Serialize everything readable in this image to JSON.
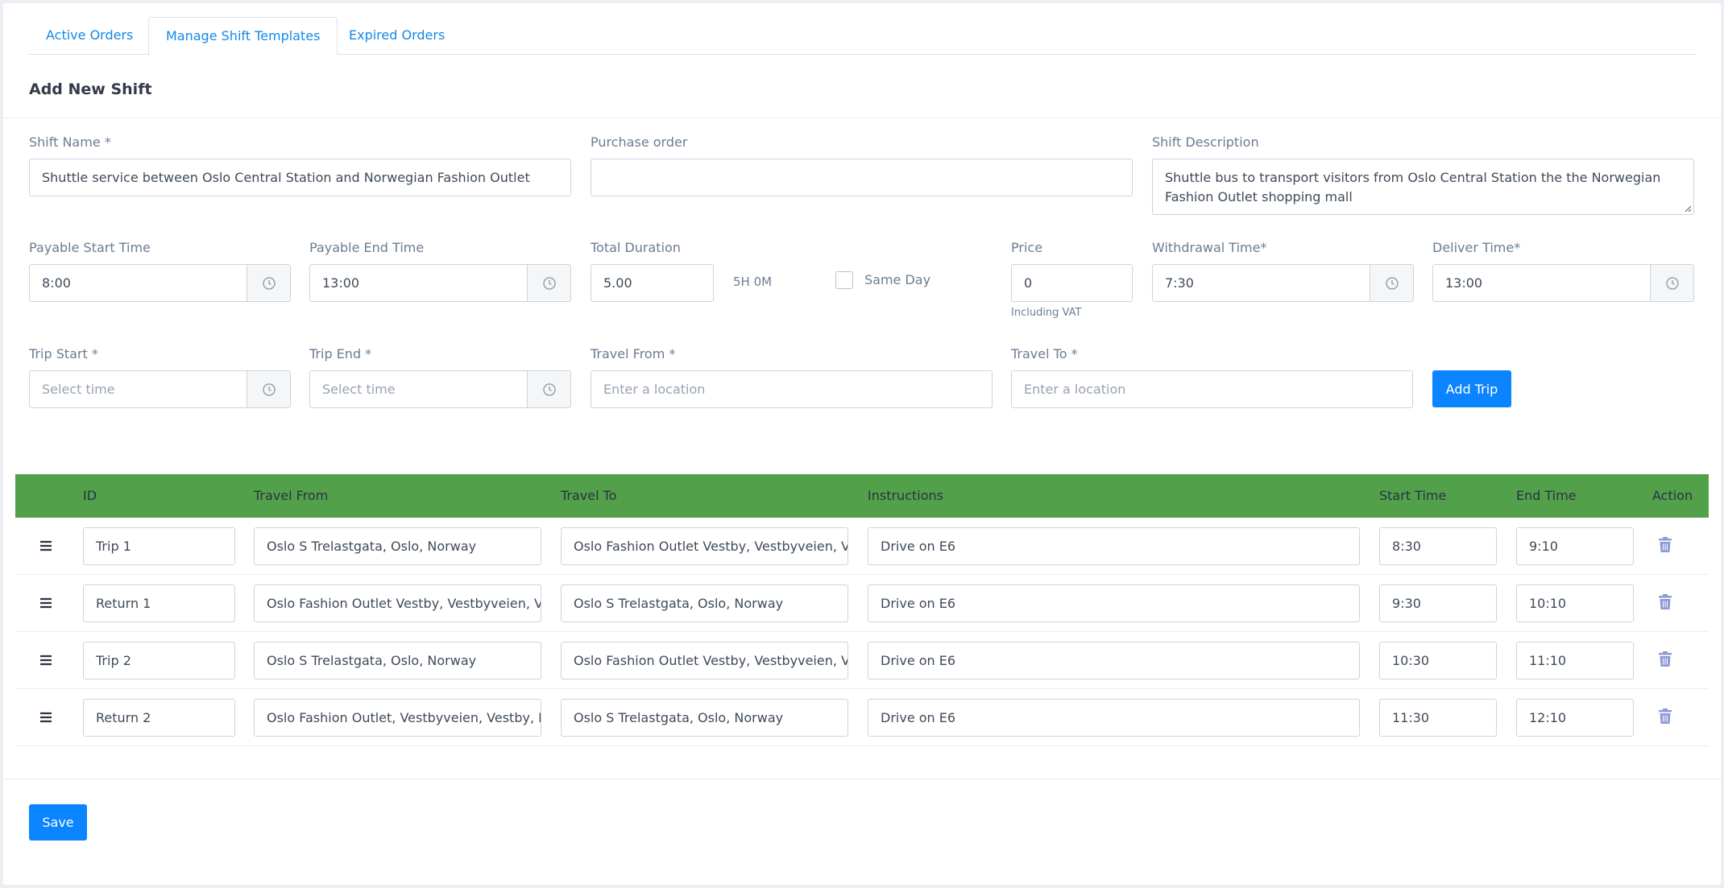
{
  "tabs": [
    {
      "label": "Active Orders",
      "active": false
    },
    {
      "label": "Manage Shift Templates",
      "active": true
    },
    {
      "label": "Expired Orders",
      "active": false
    }
  ],
  "section_title": "Add New Shift",
  "form": {
    "shift_name": {
      "label": "Shift Name *",
      "value": "Shuttle service between Oslo Central Station and Norwegian Fashion Outlet"
    },
    "purchase_order": {
      "label": "Purchase order",
      "value": ""
    },
    "shift_description": {
      "label": "Shift Description",
      "value": "Shuttle bus to transport visitors from Oslo Central Station the the Norwegian Fashion Outlet shopping mall"
    },
    "payable_start": {
      "label": "Payable Start Time",
      "value": "8:00"
    },
    "payable_end": {
      "label": "Payable End Time",
      "value": "13:00"
    },
    "total_duration": {
      "label": "Total Duration",
      "value": "5.00",
      "display": "5H 0M"
    },
    "same_day": {
      "label": "Same Day",
      "checked": false
    },
    "price": {
      "label": "Price",
      "value": "0",
      "hint": "Including VAT"
    },
    "withdrawal_time": {
      "label": "Withdrawal Time*",
      "value": "7:30"
    },
    "deliver_time": {
      "label": "Deliver Time*",
      "value": "13:00"
    },
    "trip_start": {
      "label": "Trip Start *",
      "placeholder": "Select time"
    },
    "trip_end": {
      "label": "Trip End *",
      "placeholder": "Select time"
    },
    "travel_from": {
      "label": "Travel From *",
      "placeholder": "Enter a location"
    },
    "travel_to": {
      "label": "Travel To *",
      "placeholder": "Enter a location"
    },
    "add_trip_label": "Add Trip"
  },
  "table": {
    "headers": [
      "ID",
      "Travel From",
      "Travel To",
      "Instructions",
      "Start Time",
      "End Time",
      "Action"
    ],
    "rows": [
      {
        "id": "Trip 1",
        "from": "Oslo S Trelastgata, Oslo, Norway",
        "to": "Oslo Fashion Outlet Vestby, Vestbyveien, Vestby, Norway",
        "instructions": "Drive on E6",
        "start": "8:30",
        "end": "9:10"
      },
      {
        "id": "Return 1",
        "from": "Oslo Fashion Outlet Vestby, Vestbyveien, Vestby, Norway",
        "to": "Oslo S Trelastgata, Oslo, Norway",
        "instructions": "Drive on E6",
        "start": "9:30",
        "end": "10:10"
      },
      {
        "id": "Trip 2",
        "from": "Oslo S Trelastgata, Oslo, Norway",
        "to": "Oslo Fashion Outlet Vestby, Vestbyveien, Vestby, Norway",
        "instructions": "Drive on E6",
        "start": "10:30",
        "end": "11:10"
      },
      {
        "id": "Return 2",
        "from": "Oslo Fashion Outlet, Vestbyveien, Vestby, Norway",
        "to": "Oslo S Trelastgata, Oslo, Norway",
        "instructions": "Drive on E6",
        "start": "11:30",
        "end": "12:10"
      }
    ]
  },
  "save_label": "Save",
  "colors": {
    "accent": "#0a84ff",
    "table_header": "#53a04b",
    "link": "#1388e8",
    "trash": "#8e9ad6"
  },
  "icons": {
    "clock": "clock-icon",
    "drag": "drag-handle-icon",
    "delete": "trash-icon"
  }
}
